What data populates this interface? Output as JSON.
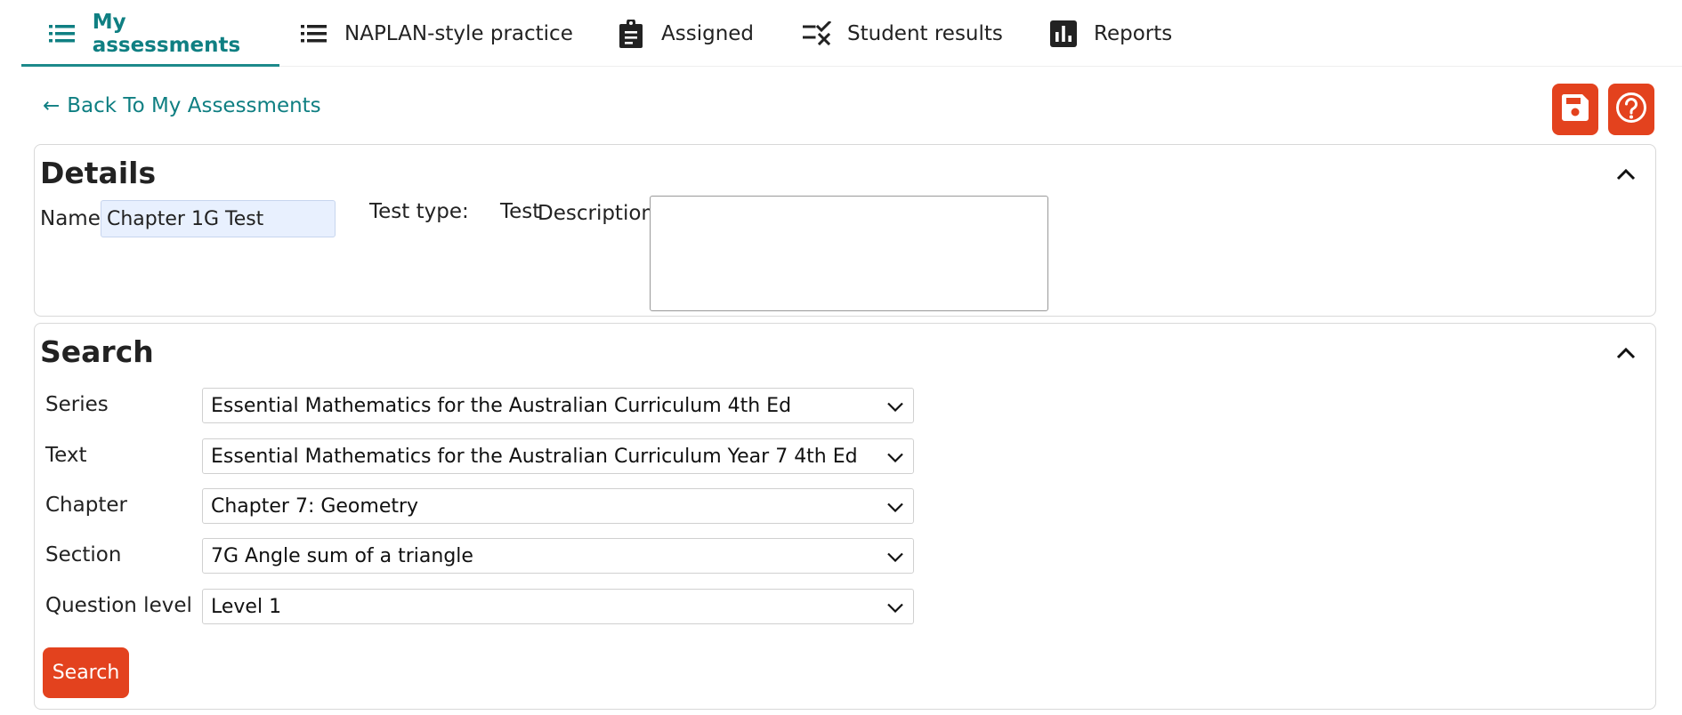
{
  "nav": {
    "tabs": [
      {
        "label": "My assessments",
        "icon": "list-icon",
        "active": true
      },
      {
        "label": "NAPLAN-style practice",
        "icon": "list-icon",
        "active": false
      },
      {
        "label": "Assigned",
        "icon": "clipboard-icon",
        "active": false
      },
      {
        "label": "Student results",
        "icon": "checklist-icon",
        "active": false
      },
      {
        "label": "Reports",
        "icon": "bar-chart-icon",
        "active": false
      }
    ]
  },
  "back_link": {
    "arrow": "←",
    "label": "Back To My Assessments"
  },
  "actions": {
    "save_icon": "floppy-disk-icon",
    "help_icon": "question-circle-icon"
  },
  "details": {
    "title": "Details",
    "name_label": "Name",
    "name_value": "Chapter 1G Test",
    "test_type_label": "Test type:",
    "test_type_value": "Test",
    "description_label": "Description",
    "description_value": ""
  },
  "search": {
    "title": "Search",
    "fields": [
      {
        "label": "Series",
        "value": "Essential Mathematics for the Australian Curriculum 4th Ed"
      },
      {
        "label": "Text",
        "value": "Essential Mathematics for the Australian Curriculum Year 7 4th Ed"
      },
      {
        "label": "Chapter",
        "value": "Chapter 7: Geometry"
      },
      {
        "label": "Section",
        "value": "7G Angle sum of a triangle"
      },
      {
        "label": "Question level",
        "value": "Level 1"
      }
    ],
    "button_label": "Search"
  },
  "colors": {
    "accent_teal": "#0f7f82",
    "brand_red": "#e3421e",
    "name_field_bg": "#e8f0fe"
  }
}
